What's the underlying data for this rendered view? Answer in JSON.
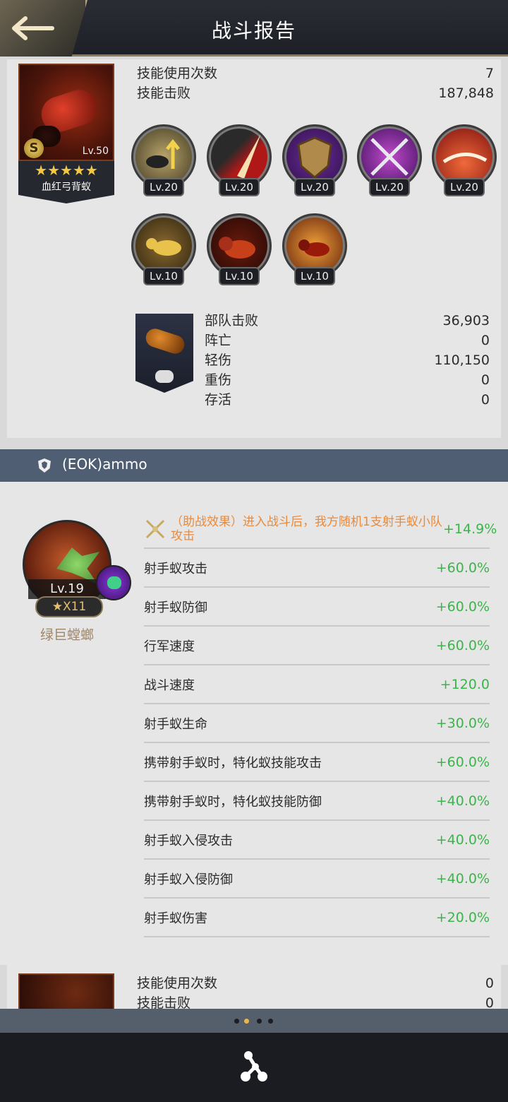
{
  "header": {
    "title": "战斗报告",
    "back_icon": "back-arrow-icon"
  },
  "hero": {
    "name": "血红弓背蚁",
    "level": "Lv.50",
    "grade_badge": "S",
    "stars": "★★★★★",
    "stats": [
      {
        "label": "技能使用次数",
        "value": "7"
      },
      {
        "label": "技能击败",
        "value": "187,848"
      }
    ],
    "skills": [
      {
        "icon": "ants-buff-arrows-icon",
        "level": "Lv.20"
      },
      {
        "icon": "red-slash-icon",
        "level": "Lv.20"
      },
      {
        "icon": "bronze-shield-icon",
        "level": "Lv.20"
      },
      {
        "icon": "crossed-swords-icon",
        "level": "Lv.20"
      },
      {
        "icon": "red-swirl-icon",
        "level": "Lv.20"
      },
      {
        "icon": "golden-ant-icon",
        "level": "Lv.10"
      },
      {
        "icon": "red-ant-icon",
        "level": "Lv.10"
      },
      {
        "icon": "fire-ant-icon",
        "level": "Lv.10"
      }
    ]
  },
  "troops": {
    "stats": [
      {
        "label": "部队击败",
        "value": "36,903"
      },
      {
        "label": "阵亡",
        "value": "0"
      },
      {
        "label": "轻伤",
        "value": "110,150"
      },
      {
        "label": "重伤",
        "value": "0"
      },
      {
        "label": "存活",
        "value": "0"
      }
    ]
  },
  "alliance": {
    "name": "(EOK)ammo"
  },
  "mantis": {
    "name": "绿巨螳螂",
    "level": "Lv.19",
    "count": "★X11",
    "special": {
      "text": "（助战效果）进入战斗后，我方随机1支射手蚁小队攻击",
      "value": "+14.9%"
    },
    "bonuses": [
      {
        "label": "射手蚁攻击",
        "value": "+60.0%"
      },
      {
        "label": "射手蚁防御",
        "value": "+60.0%"
      },
      {
        "label": "行军速度",
        "value": "+60.0%"
      },
      {
        "label": "战斗速度",
        "value": "+120.0"
      },
      {
        "label": "射手蚁生命",
        "value": "+30.0%"
      },
      {
        "label": "携带射手蚁时，特化蚁技能攻击",
        "value": "+60.0%"
      },
      {
        "label": "携带射手蚁时，特化蚁技能防御",
        "value": "+40.0%"
      },
      {
        "label": "射手蚁入侵攻击",
        "value": "+40.0%"
      },
      {
        "label": "射手蚁入侵防御",
        "value": "+40.0%"
      },
      {
        "label": "射手蚁伤害",
        "value": "+20.0%"
      }
    ]
  },
  "next_card": {
    "stats": [
      {
        "label": "技能使用次数",
        "value": "0"
      },
      {
        "label": "技能击败",
        "value": "0"
      }
    ]
  },
  "pager": {
    "pages": 4,
    "active_page": 2
  },
  "bottom": {
    "share_icon": "share-nodes-icon"
  }
}
